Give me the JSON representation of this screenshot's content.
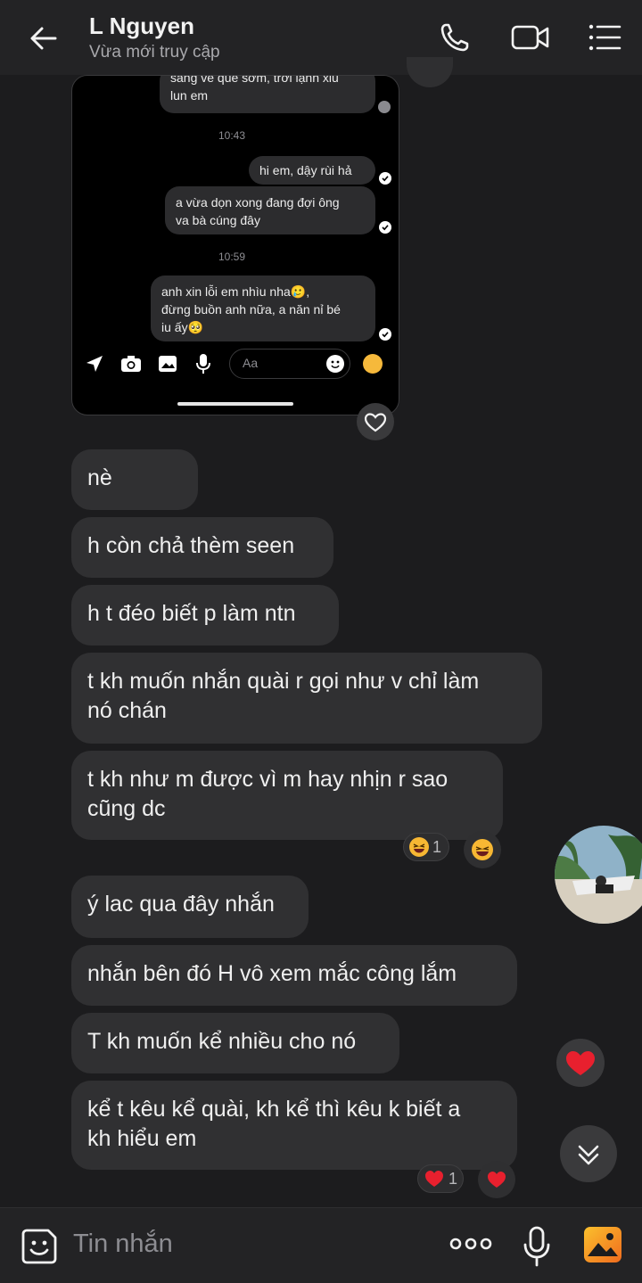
{
  "header": {
    "contact_name": "L Nguyen",
    "status": "Vừa mới truy cập",
    "icons": [
      "back-arrow-icon",
      "phone-icon",
      "video-call-icon",
      "menu-icon"
    ]
  },
  "screenshot": {
    "messages": [
      {
        "side": "in",
        "text_lines": [
          "sáng về quê sớm, trời lạnh xỉu",
          "lun em"
        ]
      },
      {
        "type": "time",
        "text": "10:43"
      },
      {
        "side": "out",
        "text_lines": [
          "hi em, dậy rùi hả"
        ]
      },
      {
        "side": "out",
        "text_lines": [
          "a vừa dọn xong đang đợi ông",
          "va bà cúng đây"
        ]
      },
      {
        "type": "time",
        "text": "10:59"
      },
      {
        "side": "out",
        "text_lines": [
          "anh xin lỗi em nhìu nha🥲,",
          "đừng buồn anh nữa, a năn nỉ bé",
          "iu ấy🥺"
        ]
      }
    ],
    "composer_placeholder": "Aa"
  },
  "messages": [
    {
      "text": "nè"
    },
    {
      "text": "h còn chả thèm seen"
    },
    {
      "text": "h t đéo biết p làm ntn"
    },
    {
      "text_lines": [
        "t kh muốn nhắn quài r gọi như v chỉ làm",
        "nó chán"
      ]
    },
    {
      "text_lines": [
        "t kh như m được vì m hay nhịn r sao",
        "cũng dc"
      ],
      "reaction": {
        "emoji": "laughing",
        "count": "1"
      }
    },
    {
      "text": "ý lac qua đây nhắn"
    },
    {
      "text": "nhắn bên đó H vô xem mắc công lắm"
    },
    {
      "text": "T kh muốn kể nhiều cho nó"
    },
    {
      "text_lines": [
        "kể t kêu kể quài, kh kể thì kêu k biết a",
        "kh hiểu em"
      ],
      "reaction": {
        "emoji": "heart",
        "count": "1"
      }
    }
  ],
  "composer": {
    "placeholder": "Tin nhắn",
    "icons": [
      "sticker-icon",
      "more-dots-icon",
      "microphone-icon",
      "image-icon"
    ]
  },
  "colors": {
    "background": "#1c1c1e",
    "bubble": "#303032",
    "topbar": "#232325",
    "heart": "#e8202e"
  }
}
